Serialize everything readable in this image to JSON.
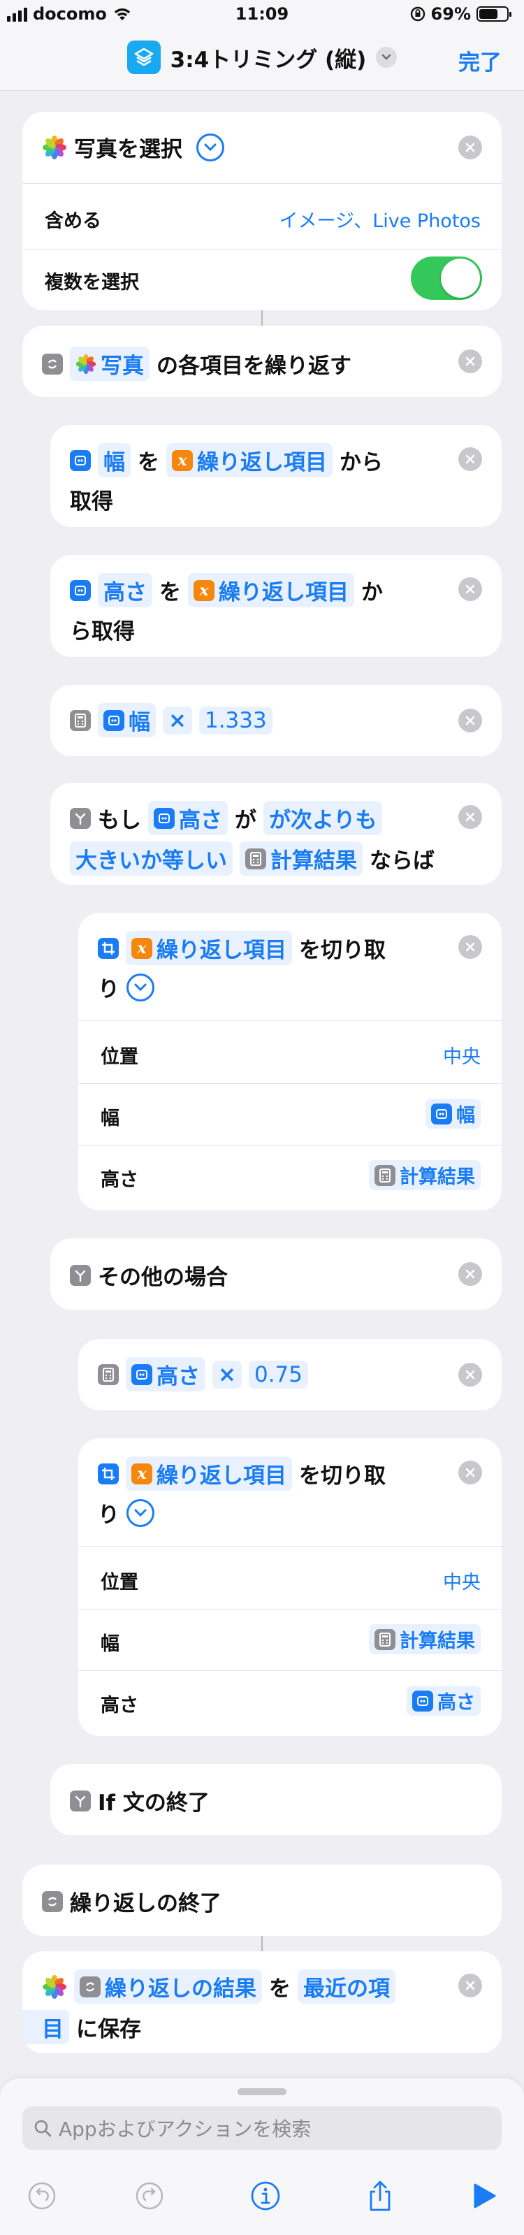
{
  "status": {
    "carrier": "docomo",
    "time": "11:09",
    "battery": "69%",
    "battery_level": 0.69
  },
  "nav": {
    "title": "3:4トリミング (縦)",
    "done": "完了"
  },
  "select_photos": {
    "title": "写真を選択",
    "include_label": "含める",
    "include_value": "イメージ、Live Photos",
    "multiple_label": "複数を選択",
    "multiple_on": true
  },
  "repeat": {
    "pill": "写真",
    "text": "の各項目を繰り返す"
  },
  "get_width": {
    "pill1": "幅",
    "text1": "を",
    "pill2": "繰り返し項目",
    "text2": "から",
    "text3": "取得"
  },
  "get_height": {
    "pill1": "高さ",
    "text1": "を",
    "pill2": "繰り返し項目",
    "text2": "か",
    "text3": "ら取得"
  },
  "calc1": {
    "operand": "幅",
    "operator": "×",
    "value": "1.333"
  },
  "if": {
    "text1": "もし",
    "pill1": "高さ",
    "text2": "が",
    "cond1": "が次よりも",
    "cond2": "大きいか等しい",
    "pill2": "計算結果",
    "text3": "ならば"
  },
  "crop1": {
    "pill": "繰り返し項目",
    "text1": "を切り取",
    "text2": "り",
    "pos_label": "位置",
    "pos_value": "中央",
    "w_label": "幅",
    "w_value": "幅",
    "h_label": "高さ",
    "h_value": "計算結果"
  },
  "else": {
    "text": "その他の場合"
  },
  "calc2": {
    "operand": "高さ",
    "operator": "×",
    "value": "0.75"
  },
  "crop2": {
    "pill": "繰り返し項目",
    "text1": "を切り取",
    "text2": "り",
    "pos_label": "位置",
    "pos_value": "中央",
    "w_label": "幅",
    "w_value": "計算結果",
    "h_label": "高さ",
    "h_value": "高さ"
  },
  "endif": {
    "text": "If 文の終了"
  },
  "endrepeat": {
    "text": "繰り返しの終了"
  },
  "save": {
    "pill1": "繰り返しの結果",
    "text1": "を",
    "pill2a": "最近の項",
    "pill2b": "目",
    "text2": "に保存"
  },
  "search": {
    "placeholder": "Appおよびアクションを検索"
  }
}
